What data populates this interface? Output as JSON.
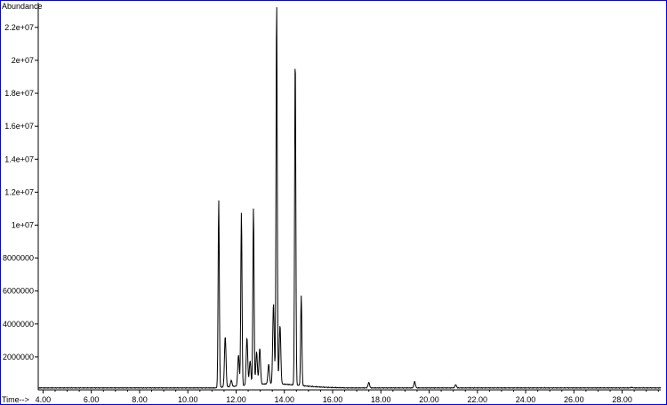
{
  "chart_data": {
    "type": "line",
    "title": "",
    "xlabel": "Time-->",
    "ylabel": "Abundance",
    "xlim": [
      3.8,
      29.6
    ],
    "ylim": [
      0,
      23500000
    ],
    "x_ticks": [
      4,
      6,
      8,
      10,
      12,
      14,
      16,
      18,
      20,
      22,
      24,
      26,
      28
    ],
    "x_tick_labels": [
      "4.00",
      "6.00",
      "8.00",
      "10.00",
      "12.00",
      "14.00",
      "16.00",
      "18.00",
      "20.00",
      "22.00",
      "24.00",
      "26.00",
      "28.00"
    ],
    "y_ticks": [
      2000000,
      4000000,
      6000000,
      8000000,
      10000000,
      12000000,
      14000000,
      16000000,
      18000000,
      20000000,
      22000000
    ],
    "y_tick_labels": [
      "2000000",
      "4000000",
      "6000000",
      "8000000",
      "1e+07",
      "1.2e+07",
      "1.4e+07",
      "1.6e+07",
      "1.8e+07",
      "2e+07",
      "2.2e+07"
    ],
    "grid": false,
    "baseline": 120000,
    "peaks": [
      {
        "x": 11.28,
        "y": 11500000
      },
      {
        "x": 11.55,
        "y": 3200000
      },
      {
        "x": 11.8,
        "y": 500000
      },
      {
        "x": 12.1,
        "y": 2000000
      },
      {
        "x": 12.22,
        "y": 10700000
      },
      {
        "x": 12.45,
        "y": 3000000
      },
      {
        "x": 12.58,
        "y": 1600000
      },
      {
        "x": 12.72,
        "y": 10900000
      },
      {
        "x": 12.85,
        "y": 2100000
      },
      {
        "x": 12.98,
        "y": 2300000
      },
      {
        "x": 13.35,
        "y": 1300000
      },
      {
        "x": 13.55,
        "y": 5000000
      },
      {
        "x": 13.68,
        "y": 23400000
      },
      {
        "x": 13.82,
        "y": 3700000
      },
      {
        "x": 14.45,
        "y": 20200000
      },
      {
        "x": 14.7,
        "y": 5600000
      },
      {
        "x": 17.5,
        "y": 450000
      },
      {
        "x": 19.4,
        "y": 500000
      },
      {
        "x": 21.1,
        "y": 320000
      },
      {
        "x": 28.4,
        "y": 150000
      }
    ]
  },
  "colors": {
    "frame": "#0000ff",
    "trace": "#000000",
    "background": "#ffffff"
  }
}
